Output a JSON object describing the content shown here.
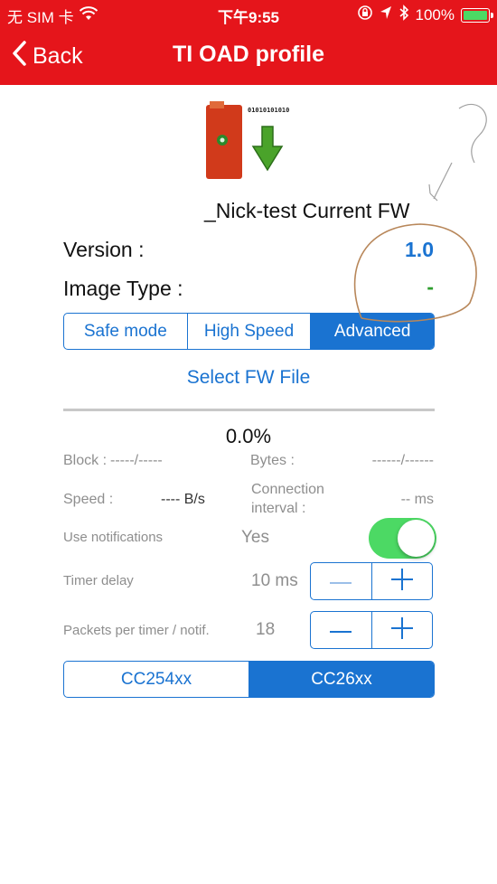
{
  "status_bar": {
    "carrier": "无 SIM 卡",
    "time": "下午9:55",
    "battery": "100%",
    "icons": [
      "wifi-icon",
      "orientation-lock-icon",
      "location-arrow-icon",
      "bluetooth-icon",
      "battery-icon"
    ]
  },
  "nav": {
    "back_label": "Back",
    "title": "TI OAD profile"
  },
  "header": {
    "fw_title": "_Nick-test Current FW",
    "graphic_binary_text": "01010101010"
  },
  "info": {
    "version_label": "Version :",
    "version_value": "1.0",
    "image_type_label": "Image Type :",
    "image_type_value": "-"
  },
  "mode_segment": {
    "options": [
      "Safe mode",
      "High Speed",
      "Advanced"
    ],
    "selected": "Advanced"
  },
  "select_fw_label": "Select FW File",
  "progress": {
    "percent_text": "0.0%",
    "value": 0
  },
  "stats": {
    "block_label": "Block :",
    "block_value": "-----/-----",
    "bytes_label": "Bytes :",
    "bytes_value": "------/------",
    "speed_label": "Speed :",
    "speed_value": "---- B/s",
    "connection_label_line1": "Connection",
    "connection_label_line2": "interval :",
    "connection_value": "-- ms"
  },
  "settings": {
    "notifications_label": "Use notifications",
    "notifications_value": "Yes",
    "notifications_on": true,
    "timer_delay_label": "Timer delay",
    "timer_delay_value": "10 ms",
    "packets_label": "Packets per timer / notif.",
    "packets_value": "18"
  },
  "chip_segment": {
    "options": [
      "CC254xx",
      "CC26xx"
    ],
    "selected": "CC26xx"
  },
  "colors": {
    "accent_red": "#e5151b",
    "accent_blue": "#1a73d1",
    "toggle_green": "#4cd964",
    "image_type_green": "#2e9e2e"
  }
}
